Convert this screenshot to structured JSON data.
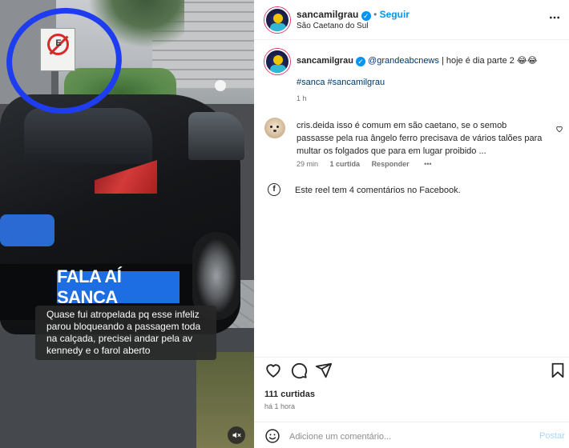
{
  "post": {
    "banner_title": "FALA AÍ SANCA",
    "banner_caption": "Quase fui atropelada pq esse infeliz parou bloqueando a passagem toda na calçada, precisei andar pela av kennedy e o farol aberto",
    "sign_letter": "E"
  },
  "header": {
    "username": "sancamilgrau",
    "separator": "•",
    "follow_label": "Seguir",
    "location": "São Caetano do Sul"
  },
  "caption": {
    "username": "sancamilgrau",
    "mention": "@grandeabcnews",
    "text": " | hoje é dia parte 2 😂😂",
    "hashtags": "#sanca #sancamilgrau",
    "time": "1 h"
  },
  "comments": [
    {
      "username": "cris.deida",
      "text": "isso é comum em são caetano, se o semob passasse pela rua ângelo ferro precisava de vários talões para multar os folgados que para em lugar proibido ...",
      "time": "29 min",
      "likes": "1 curtida",
      "reply_label": "Responder",
      "more": "•••"
    }
  ],
  "facebook_note": "Este reel tem 4 comentários no Facebook.",
  "stats": {
    "likes": "111 curtidas",
    "posted": "há 1 hora"
  },
  "comment_box": {
    "placeholder": "Adicione um comentário...",
    "post_label": "Postar"
  },
  "icons": {
    "more": "more-options-icon",
    "verified": "verified-badge-icon",
    "like": "heart-icon",
    "comment": "comment-icon",
    "share": "share-icon",
    "save": "bookmark-icon",
    "emoji": "emoji-icon",
    "facebook": "facebook-icon",
    "mute": "muted-speaker-icon",
    "comment_like": "heart-icon"
  },
  "colors": {
    "accent": "#0095f6",
    "banner_blue": "#1d6de3",
    "marker_blue": "#1f3df0"
  }
}
